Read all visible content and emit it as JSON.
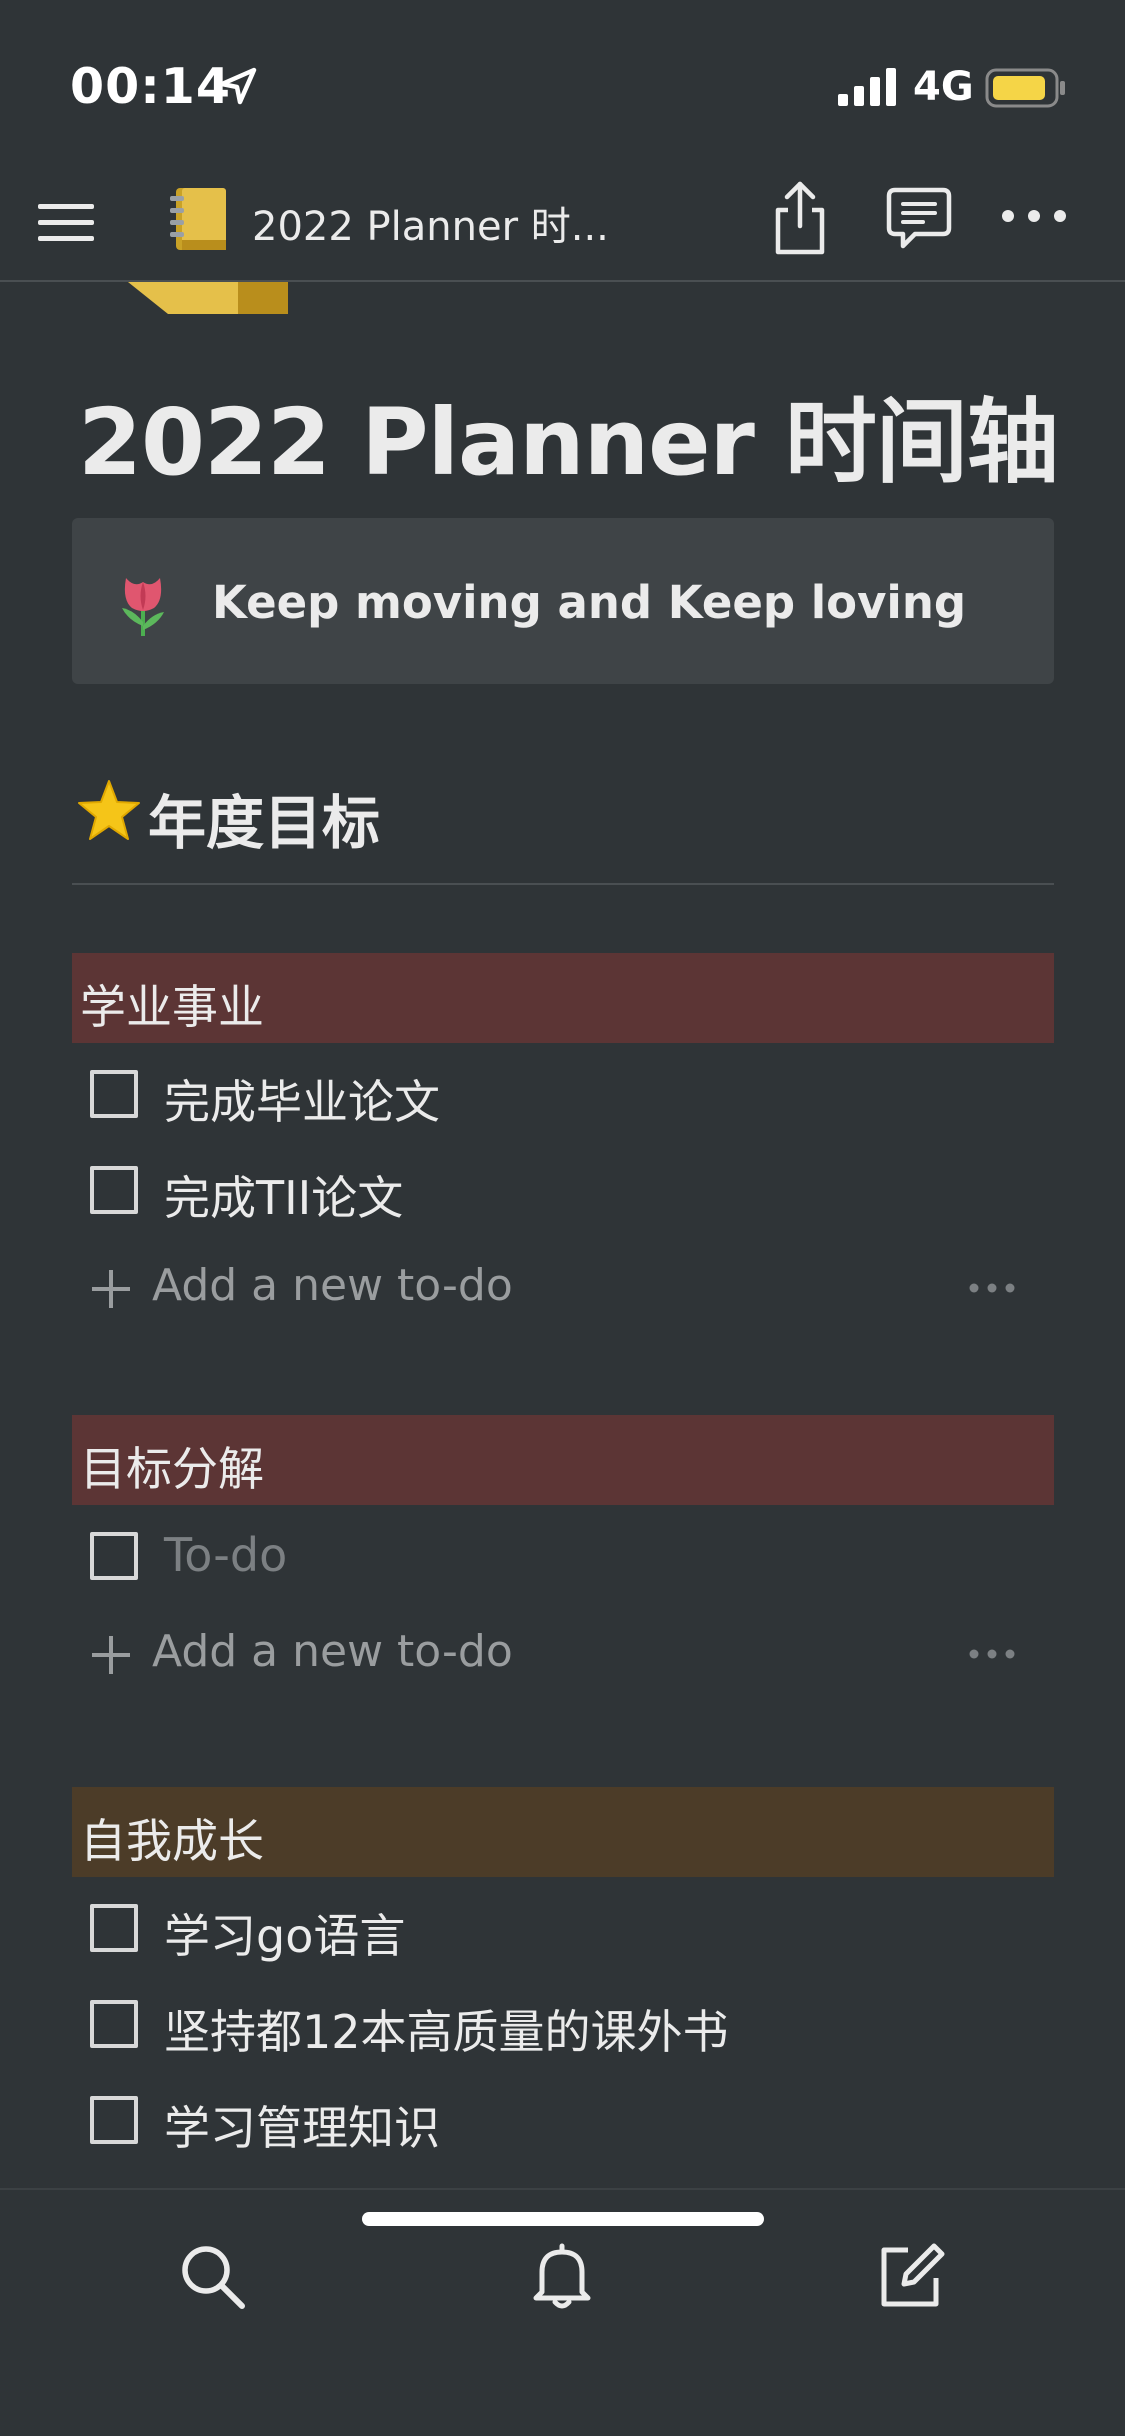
{
  "status_bar": {
    "time": "00:14",
    "network": "4G",
    "battery_color": "#f5d547"
  },
  "nav": {
    "title": "2022 Planner 时...",
    "icons": [
      "menu-icon",
      "notebook-icon",
      "share-icon",
      "comment-icon",
      "more-icon"
    ]
  },
  "page": {
    "title": "2022 Planner 时间轴",
    "callout": {
      "icon": "tulip-icon",
      "text": "Keep moving and Keep loving"
    },
    "goals_heading": "年度目标",
    "sections": [
      {
        "label": "学业事业",
        "color": "#5c3535",
        "todos": [
          "完成毕业论文",
          "完成TII论文"
        ],
        "add_label": "Add a new to-do"
      },
      {
        "label": "目标分解",
        "color": "#5c3535",
        "todo_placeholder": "To-do",
        "add_label": "Add a new to-do"
      },
      {
        "label": "自我成长",
        "color": "#4c3c28",
        "todos": [
          "学习go语言",
          "坚持都12本高质量的课外书",
          "学习管理知识"
        ]
      }
    ]
  },
  "bottom_tabs": [
    "search-icon",
    "bell-icon",
    "compose-icon"
  ]
}
